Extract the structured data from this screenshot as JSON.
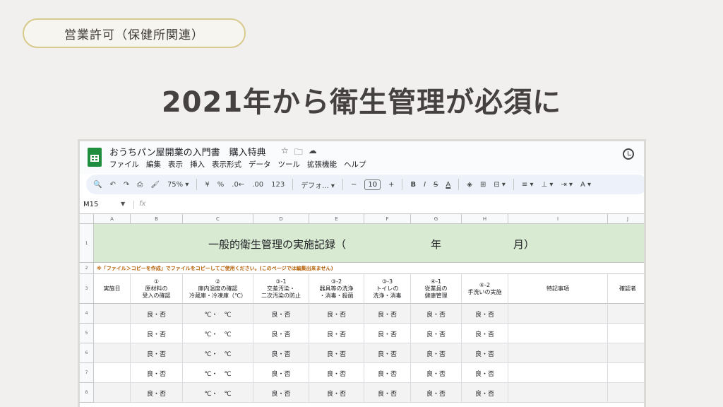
{
  "badge": "営業許可（保健所関連）",
  "headline": "2021年から衛生管理が必須に",
  "sheet": {
    "doc_title": "おうちパン屋開業の入門書　購入特典",
    "menus": [
      "ファイル",
      "編集",
      "表示",
      "挿入",
      "表示形式",
      "データ",
      "ツール",
      "拡張機能",
      "ヘルプ"
    ],
    "toolbar": {
      "zoom": "75%",
      "currency": "¥",
      "percent": "%",
      "dec_minus": ".0←",
      "dec_plus": ".00",
      "number_format": "123",
      "font": "デフォ...",
      "font_size": "10",
      "minus": "−",
      "plus": "+",
      "bold": "B",
      "italic": "I",
      "strike": "S",
      "text_color": "A"
    },
    "cell_ref": "M15",
    "fx": "fx",
    "columns": [
      "A",
      "B",
      "C",
      "D",
      "E",
      "F",
      "G",
      "H",
      "I",
      "J"
    ],
    "rows": [
      "1",
      "2",
      "3",
      "4",
      "5",
      "6",
      "7",
      "8"
    ],
    "title_row": {
      "left": "一般的衛生管理の実施記録（",
      "year": "年",
      "month": "月）"
    },
    "note": "※「ファイル＞コピーを作成」でファイルをコピーしてご使用ください。(このページでは編集出来ません)",
    "headers": [
      "実施日",
      "①\n原材料の\n受入の確認",
      "②\n庫内温度の確認\n冷蔵庫・冷凍庫（℃）",
      "③-1\n交差汚染・\n二次汚染の防止",
      "③-2\n器具等の洗浄\n・消毒・殺菌",
      "③-3\nトイレの\n洗浄・消毒",
      "④-1\n従業員の\n健康管理",
      "④-2\n手洗いの実施",
      "特記事項",
      "確認者"
    ],
    "check": "良・否",
    "temp": "℃・　℃"
  }
}
